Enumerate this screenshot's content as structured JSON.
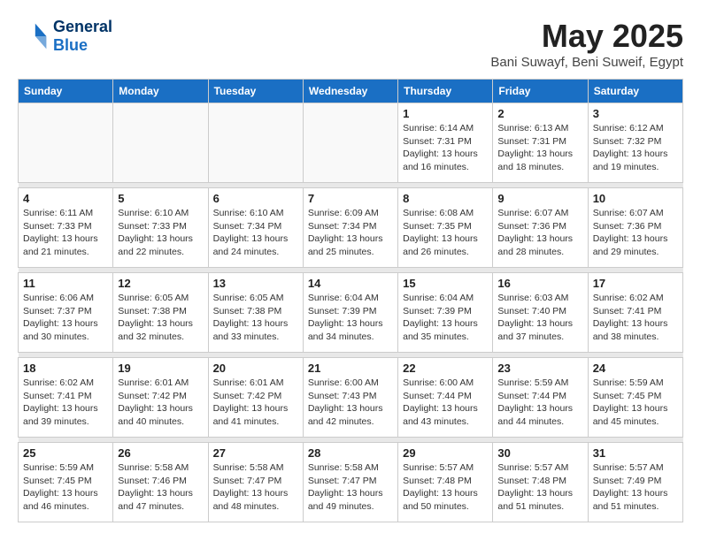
{
  "logo": {
    "line1": "General",
    "line2": "Blue"
  },
  "title": "May 2025",
  "location": "Bani Suwayf, Beni Suweif, Egypt",
  "days_of_week": [
    "Sunday",
    "Monday",
    "Tuesday",
    "Wednesday",
    "Thursday",
    "Friday",
    "Saturday"
  ],
  "weeks": [
    [
      {
        "day": "",
        "info": ""
      },
      {
        "day": "",
        "info": ""
      },
      {
        "day": "",
        "info": ""
      },
      {
        "day": "",
        "info": ""
      },
      {
        "day": "1",
        "info": "Sunrise: 6:14 AM\nSunset: 7:31 PM\nDaylight: 13 hours\nand 16 minutes."
      },
      {
        "day": "2",
        "info": "Sunrise: 6:13 AM\nSunset: 7:31 PM\nDaylight: 13 hours\nand 18 minutes."
      },
      {
        "day": "3",
        "info": "Sunrise: 6:12 AM\nSunset: 7:32 PM\nDaylight: 13 hours\nand 19 minutes."
      }
    ],
    [
      {
        "day": "4",
        "info": "Sunrise: 6:11 AM\nSunset: 7:33 PM\nDaylight: 13 hours\nand 21 minutes."
      },
      {
        "day": "5",
        "info": "Sunrise: 6:10 AM\nSunset: 7:33 PM\nDaylight: 13 hours\nand 22 minutes."
      },
      {
        "day": "6",
        "info": "Sunrise: 6:10 AM\nSunset: 7:34 PM\nDaylight: 13 hours\nand 24 minutes."
      },
      {
        "day": "7",
        "info": "Sunrise: 6:09 AM\nSunset: 7:34 PM\nDaylight: 13 hours\nand 25 minutes."
      },
      {
        "day": "8",
        "info": "Sunrise: 6:08 AM\nSunset: 7:35 PM\nDaylight: 13 hours\nand 26 minutes."
      },
      {
        "day": "9",
        "info": "Sunrise: 6:07 AM\nSunset: 7:36 PM\nDaylight: 13 hours\nand 28 minutes."
      },
      {
        "day": "10",
        "info": "Sunrise: 6:07 AM\nSunset: 7:36 PM\nDaylight: 13 hours\nand 29 minutes."
      }
    ],
    [
      {
        "day": "11",
        "info": "Sunrise: 6:06 AM\nSunset: 7:37 PM\nDaylight: 13 hours\nand 30 minutes."
      },
      {
        "day": "12",
        "info": "Sunrise: 6:05 AM\nSunset: 7:38 PM\nDaylight: 13 hours\nand 32 minutes."
      },
      {
        "day": "13",
        "info": "Sunrise: 6:05 AM\nSunset: 7:38 PM\nDaylight: 13 hours\nand 33 minutes."
      },
      {
        "day": "14",
        "info": "Sunrise: 6:04 AM\nSunset: 7:39 PM\nDaylight: 13 hours\nand 34 minutes."
      },
      {
        "day": "15",
        "info": "Sunrise: 6:04 AM\nSunset: 7:39 PM\nDaylight: 13 hours\nand 35 minutes."
      },
      {
        "day": "16",
        "info": "Sunrise: 6:03 AM\nSunset: 7:40 PM\nDaylight: 13 hours\nand 37 minutes."
      },
      {
        "day": "17",
        "info": "Sunrise: 6:02 AM\nSunset: 7:41 PM\nDaylight: 13 hours\nand 38 minutes."
      }
    ],
    [
      {
        "day": "18",
        "info": "Sunrise: 6:02 AM\nSunset: 7:41 PM\nDaylight: 13 hours\nand 39 minutes."
      },
      {
        "day": "19",
        "info": "Sunrise: 6:01 AM\nSunset: 7:42 PM\nDaylight: 13 hours\nand 40 minutes."
      },
      {
        "day": "20",
        "info": "Sunrise: 6:01 AM\nSunset: 7:42 PM\nDaylight: 13 hours\nand 41 minutes."
      },
      {
        "day": "21",
        "info": "Sunrise: 6:00 AM\nSunset: 7:43 PM\nDaylight: 13 hours\nand 42 minutes."
      },
      {
        "day": "22",
        "info": "Sunrise: 6:00 AM\nSunset: 7:44 PM\nDaylight: 13 hours\nand 43 minutes."
      },
      {
        "day": "23",
        "info": "Sunrise: 5:59 AM\nSunset: 7:44 PM\nDaylight: 13 hours\nand 44 minutes."
      },
      {
        "day": "24",
        "info": "Sunrise: 5:59 AM\nSunset: 7:45 PM\nDaylight: 13 hours\nand 45 minutes."
      }
    ],
    [
      {
        "day": "25",
        "info": "Sunrise: 5:59 AM\nSunset: 7:45 PM\nDaylight: 13 hours\nand 46 minutes."
      },
      {
        "day": "26",
        "info": "Sunrise: 5:58 AM\nSunset: 7:46 PM\nDaylight: 13 hours\nand 47 minutes."
      },
      {
        "day": "27",
        "info": "Sunrise: 5:58 AM\nSunset: 7:47 PM\nDaylight: 13 hours\nand 48 minutes."
      },
      {
        "day": "28",
        "info": "Sunrise: 5:58 AM\nSunset: 7:47 PM\nDaylight: 13 hours\nand 49 minutes."
      },
      {
        "day": "29",
        "info": "Sunrise: 5:57 AM\nSunset: 7:48 PM\nDaylight: 13 hours\nand 50 minutes."
      },
      {
        "day": "30",
        "info": "Sunrise: 5:57 AM\nSunset: 7:48 PM\nDaylight: 13 hours\nand 51 minutes."
      },
      {
        "day": "31",
        "info": "Sunrise: 5:57 AM\nSunset: 7:49 PM\nDaylight: 13 hours\nand 51 minutes."
      }
    ]
  ]
}
